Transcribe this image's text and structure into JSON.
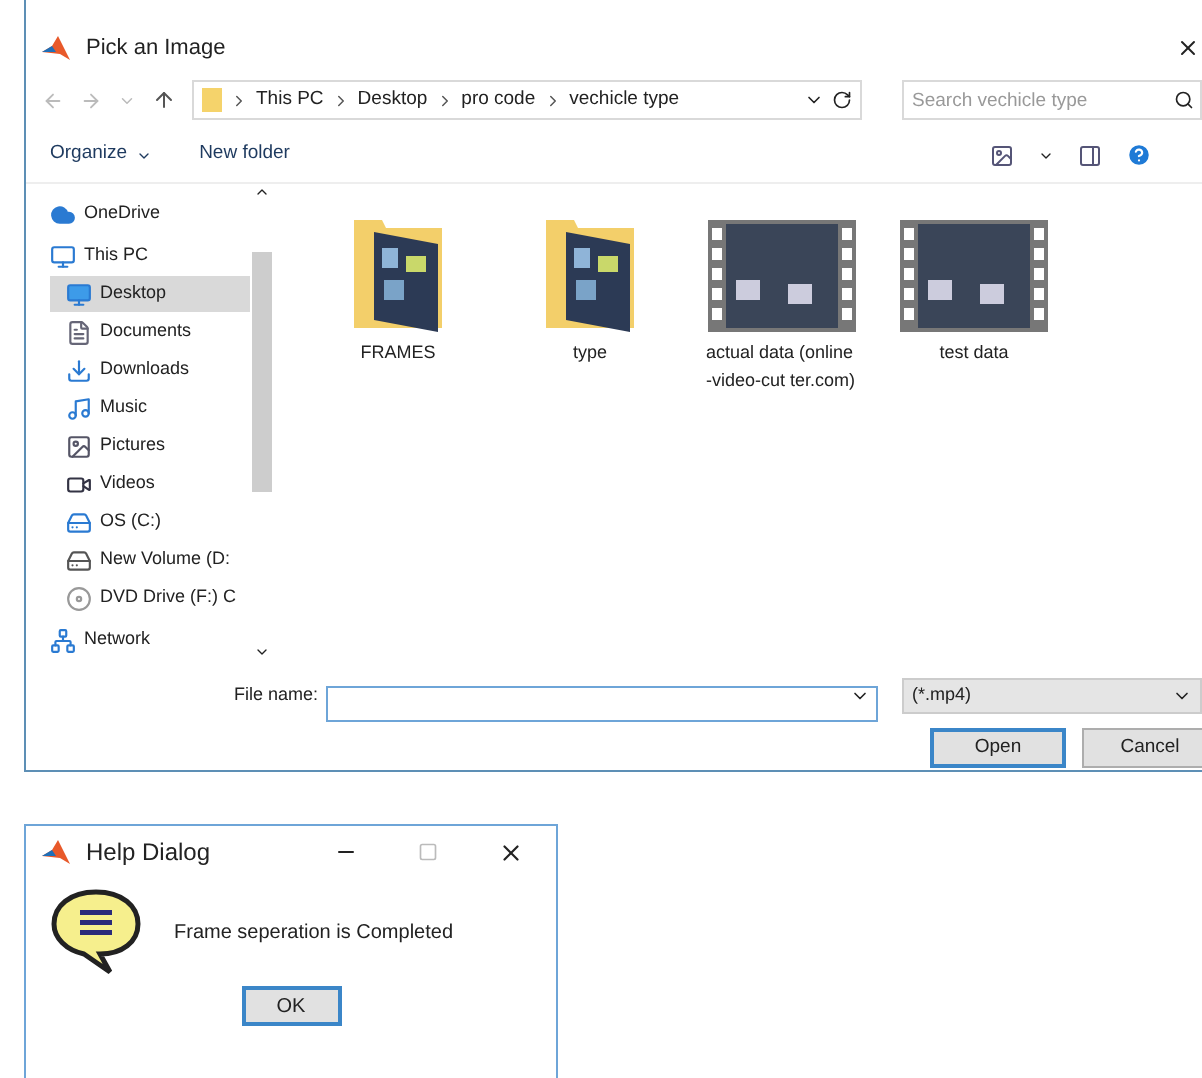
{
  "file_dialog": {
    "title": "Pick an Image",
    "breadcrumb": [
      "This PC",
      "Desktop",
      "pro code",
      "vechicle type"
    ],
    "search": {
      "placeholder": "Search vechicle type"
    },
    "toolbar": [
      "Organize",
      "New folder"
    ],
    "sidebar": [
      {
        "label": "OneDrive",
        "kind": "cloud",
        "selected": false
      },
      {
        "label": "This PC",
        "kind": "pc",
        "selected": false
      },
      {
        "label": "Desktop",
        "kind": "desktop",
        "selected": true
      },
      {
        "label": "Documents",
        "kind": "documents",
        "selected": false
      },
      {
        "label": "Downloads",
        "kind": "downloads",
        "selected": false
      },
      {
        "label": "Music",
        "kind": "music",
        "selected": false
      },
      {
        "label": "Pictures",
        "kind": "pictures",
        "selected": false
      },
      {
        "label": "Videos",
        "kind": "videos",
        "selected": false
      },
      {
        "label": "OS (C:)",
        "kind": "os",
        "selected": false
      },
      {
        "label": "New Volume (D:",
        "kind": "drive",
        "selected": false
      },
      {
        "label": "DVD Drive (F:) C",
        "kind": "dvd",
        "selected": false
      },
      {
        "label": "Network",
        "kind": "network",
        "selected": false
      }
    ],
    "files": [
      {
        "name": "FRAMES",
        "kind": "folder"
      },
      {
        "name": "type",
        "kind": "folder"
      },
      {
        "name": "actual data (online-video-cut ter.com)",
        "kind": "video"
      },
      {
        "name": "test data",
        "kind": "video"
      }
    ],
    "file_name_label": "File name:",
    "file_type": "(*.mp4)",
    "buttons": [
      "Open",
      "Cancel"
    ]
  },
  "help_dialog": {
    "title": "Help Dialog",
    "message": "Frame seperation is Completed",
    "button": "OK"
  }
}
